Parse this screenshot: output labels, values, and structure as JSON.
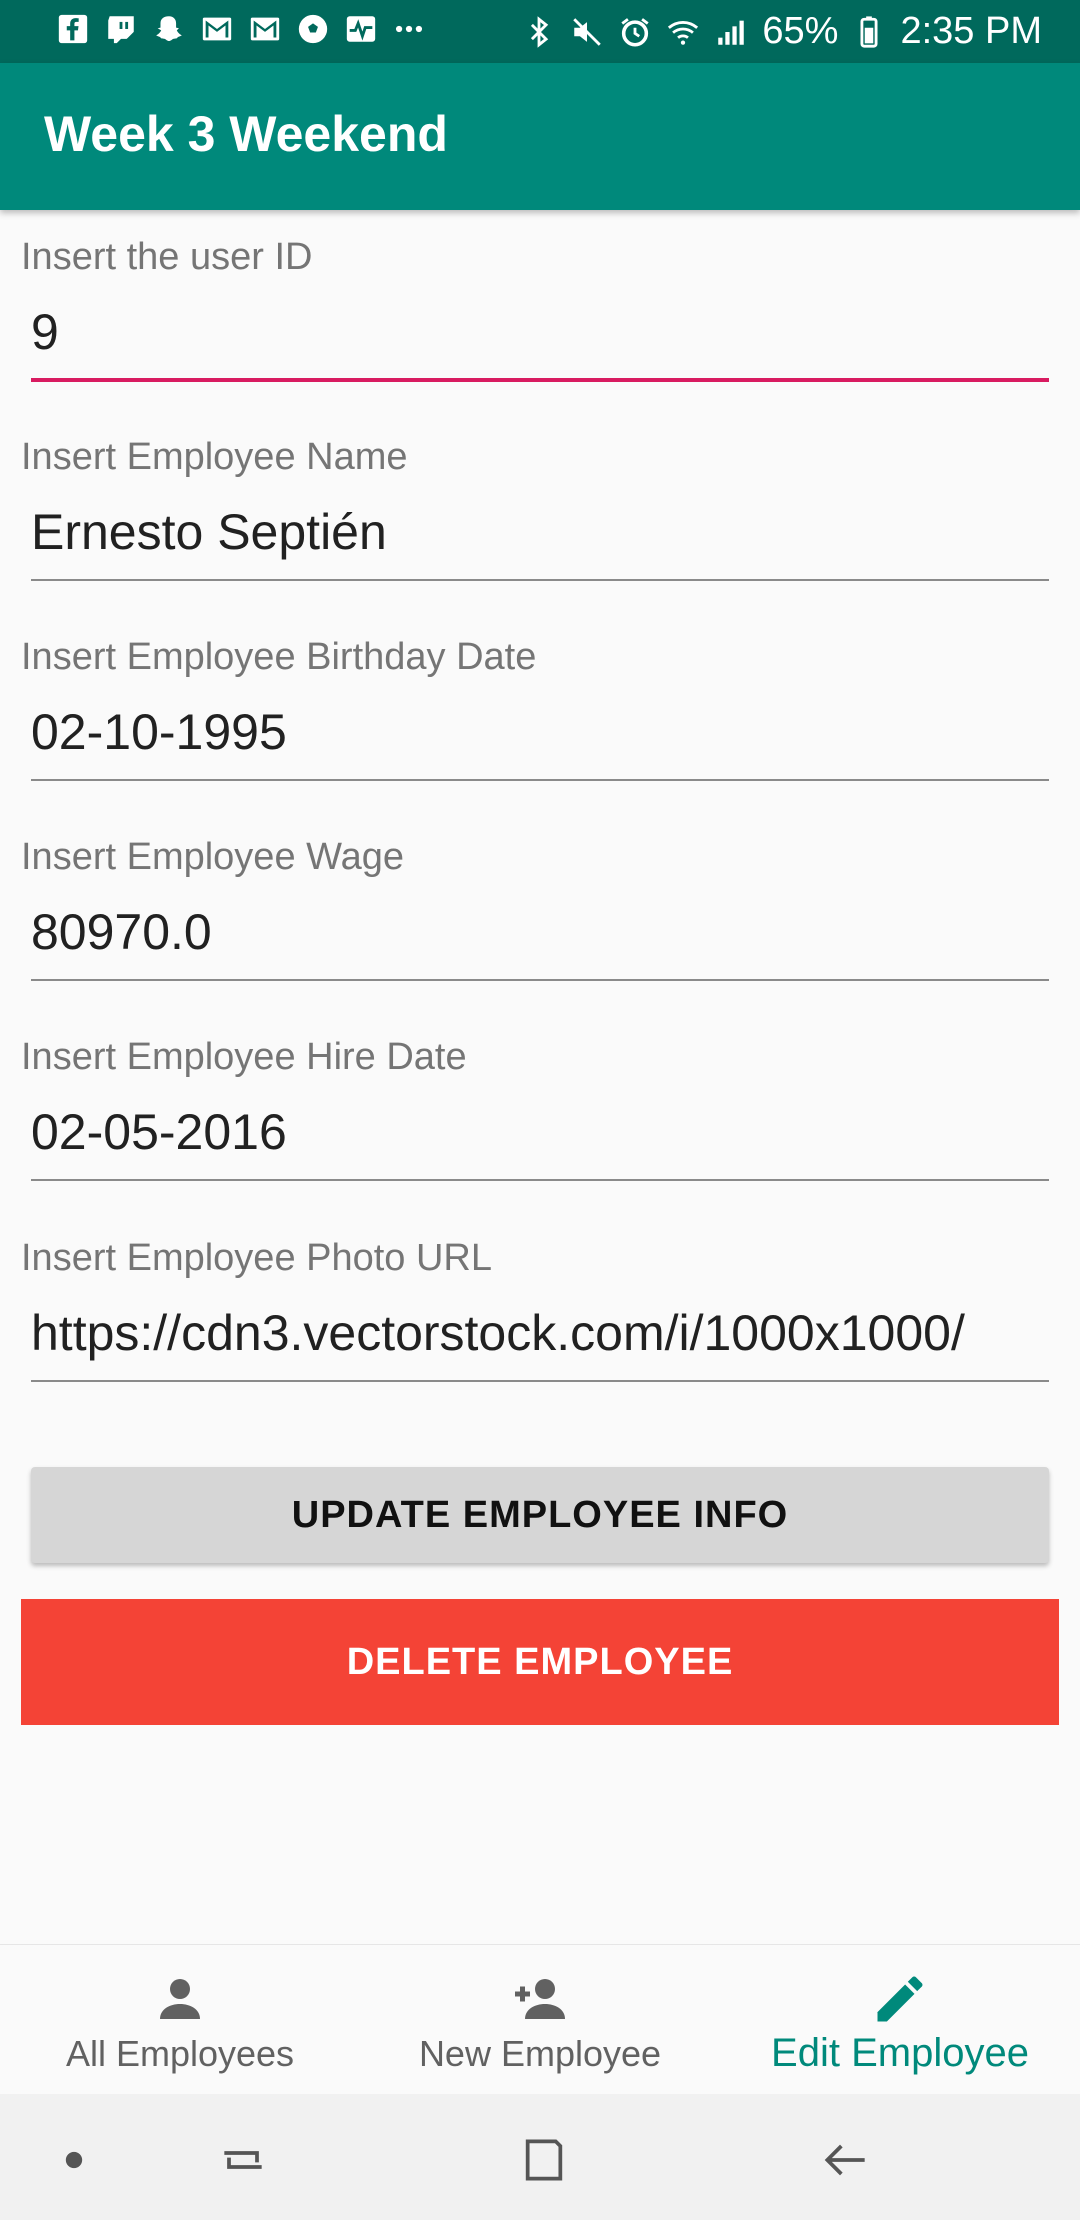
{
  "status_bar": {
    "battery": "65%",
    "time": "2:35 PM",
    "left_icons": [
      "facebook-icon",
      "twitch-icon",
      "snapchat-icon",
      "gmail-icon",
      "gmail-icon",
      "soccer-icon",
      "activity-icon",
      "more-dots-icon"
    ],
    "right_icons": [
      "bluetooth-icon",
      "mute-icon",
      "alarm-icon",
      "wifi-icon",
      "signal-icon",
      "battery-icon"
    ]
  },
  "app_bar": {
    "title": "Week 3 Weekend"
  },
  "form": {
    "user_id": {
      "label": "Insert the user ID",
      "value": "9"
    },
    "name": {
      "label": "Insert Employee Name",
      "value": "Ernesto Septién"
    },
    "birthday": {
      "label": "Insert Employee Birthday Date",
      "value": "02-10-1995"
    },
    "wage": {
      "label": "Insert Employee Wage",
      "value": "80970.0"
    },
    "hire_date": {
      "label": "Insert Employee Hire Date",
      "value": "02-05-2016"
    },
    "photo_url": {
      "label": "Insert Employee Photo URL",
      "value": "https://cdn3.vectorstock.com/i/1000x1000/"
    }
  },
  "buttons": {
    "update": "UPDATE EMPLOYEE INFO",
    "delete": "DELETE EMPLOYEE"
  },
  "bottom_nav": {
    "items": [
      {
        "label": "All Employees",
        "icon": "person-icon"
      },
      {
        "label": "New Employee",
        "icon": "person-add-icon"
      },
      {
        "label": "Edit Employee",
        "icon": "edit-pencil-icon",
        "active": true
      }
    ]
  },
  "colors": {
    "status_bar": "#00695c",
    "primary": "#00897b",
    "accent": "#d81b60",
    "delete": "#f44336"
  }
}
